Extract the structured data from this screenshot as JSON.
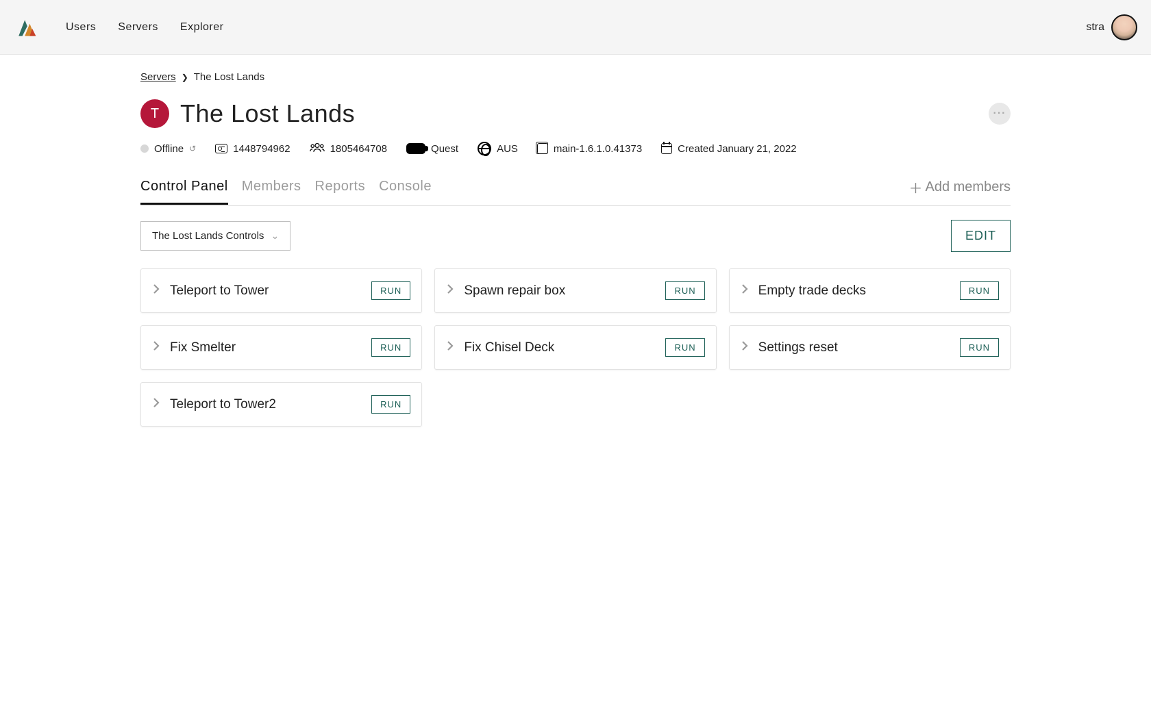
{
  "nav": {
    "items": [
      "Users",
      "Servers",
      "Explorer"
    ]
  },
  "user": {
    "name": "stra"
  },
  "breadcrumb": {
    "root": "Servers",
    "current": "The Lost Lands"
  },
  "server": {
    "badge_letter": "T",
    "title": "The Lost Lands",
    "status": "Offline",
    "id": "1448794962",
    "group_id": "1805464708",
    "platform": "Quest",
    "region": "AUS",
    "version": "main-1.6.1.0.41373",
    "created": "Created January 21, 2022"
  },
  "tabs": {
    "items": [
      "Control Panel",
      "Members",
      "Reports",
      "Console"
    ],
    "active_index": 0,
    "add_members_label": "Add members"
  },
  "controls": {
    "dropdown_label": "The Lost Lands Controls",
    "edit_label": "EDIT",
    "run_label": "RUN",
    "cards": [
      "Teleport to Tower",
      "Spawn repair box",
      "Empty trade decks",
      "Fix Smelter",
      "Fix Chisel Deck",
      "Settings reset",
      "Teleport to Tower2"
    ]
  },
  "colors": {
    "brand_red": "#b5173a",
    "accent_teal": "#1e6057"
  }
}
